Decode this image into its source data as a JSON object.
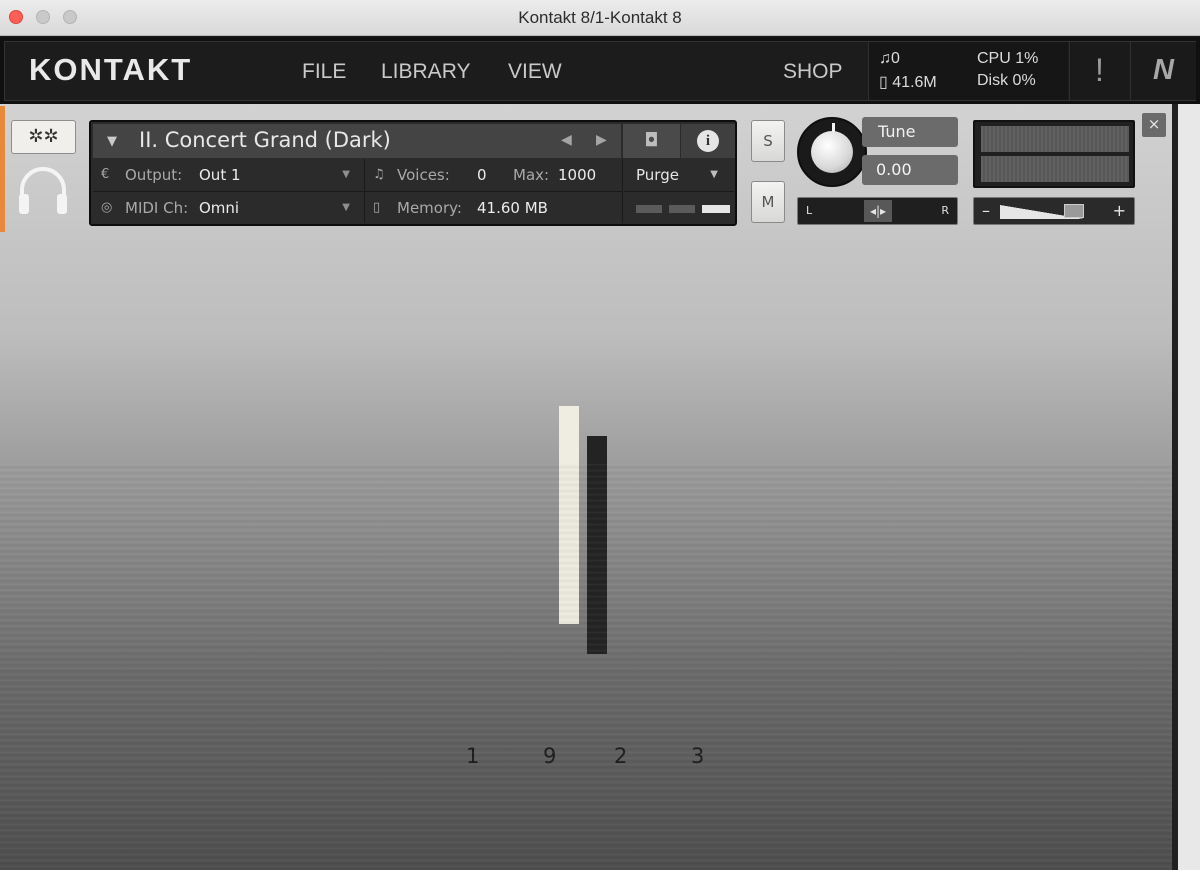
{
  "window": {
    "title": "Kontakt 8/1-Kontakt 8"
  },
  "header": {
    "logo": "KONTAKT",
    "menu": [
      "FILE",
      "LIBRARY",
      "VIEW"
    ],
    "shop": "SHOP",
    "voices": "0",
    "memory": "41.6M",
    "cpu": "CPU 1%",
    "disk": "Disk 0%",
    "alert_symbol": "!",
    "ni_logo": "N",
    "voices_icon": "note-icon",
    "memory_icon": "memory-icon"
  },
  "instrument": {
    "name": "II. Concert Grand (Dark)",
    "output_label": "Output:",
    "output_value": "Out 1",
    "midi_label": "MIDI Ch:",
    "midi_value": "Omni",
    "voices_label": "Voices:",
    "voices_value": "0",
    "max_label": "Max:",
    "max_value": "1000",
    "memory_label": "Memory:",
    "memory_value": "41.60 MB",
    "purge_label": "Purge",
    "solo": "S",
    "mute": "M",
    "tune_label": "Tune",
    "tune_value": "0.00",
    "pan_left": "L",
    "pan_right": "R",
    "vol_minus": "–",
    "vol_plus": "+",
    "info": "i",
    "close": "×"
  },
  "artwork": {
    "numbers": [
      "1",
      "9",
      "2",
      "3"
    ],
    "bar_light_color": "#efece1",
    "bar_dark_color": "#232323"
  },
  "colors": {
    "accent": "#e8893a",
    "close_button": "#fe5f57"
  }
}
